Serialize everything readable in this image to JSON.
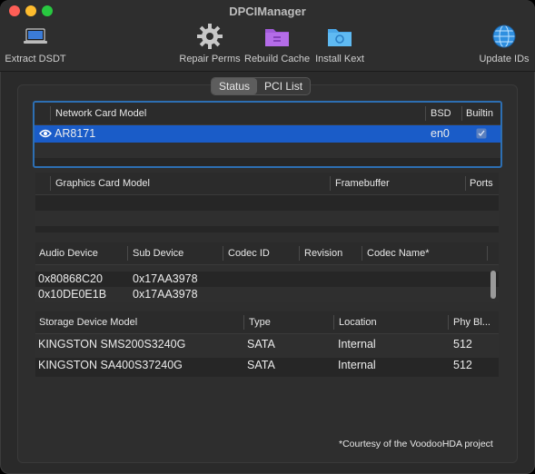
{
  "window": {
    "title": "DPCIManager"
  },
  "toolbar": {
    "extract_dsdt": "Extract DSDT",
    "repair_perms": "Repair Perms",
    "rebuild_cache": "Rebuild Cache",
    "install_kext": "Install Kext",
    "update_ids": "Update IDs"
  },
  "tabs": {
    "status": "Status",
    "pci_list": "PCI List"
  },
  "network": {
    "headers": {
      "model": "Network Card Model",
      "bsd": "BSD",
      "builtin": "Builtin"
    },
    "rows": [
      {
        "model": "AR8171",
        "bsd": "en0",
        "builtin": true
      }
    ]
  },
  "graphics": {
    "headers": {
      "model": "Graphics Card Model",
      "framebuffer": "Framebuffer",
      "ports": "Ports"
    }
  },
  "audio": {
    "headers": {
      "device": "Audio Device",
      "sub_device": "Sub Device",
      "codec_id": "Codec ID",
      "revision": "Revision",
      "codec_name": "Codec Name*"
    },
    "rows": [
      {
        "device": "0x80868C20",
        "sub_device": "0x17AA3978"
      },
      {
        "device": "0x10DE0E1B",
        "sub_device": "0x17AA3978"
      }
    ]
  },
  "storage": {
    "headers": {
      "model": "Storage Device Model",
      "type": "Type",
      "location": "Location",
      "phy": "Phy Bl..."
    },
    "rows": [
      {
        "model": "KINGSTON SMS200S3240G",
        "type": "SATA",
        "location": "Internal",
        "phy": "512"
      },
      {
        "model": "KINGSTON SA400S37240G",
        "type": "SATA",
        "location": "Internal",
        "phy": "512"
      }
    ]
  },
  "footer": "*Courtesy of the VoodooHDA project"
}
